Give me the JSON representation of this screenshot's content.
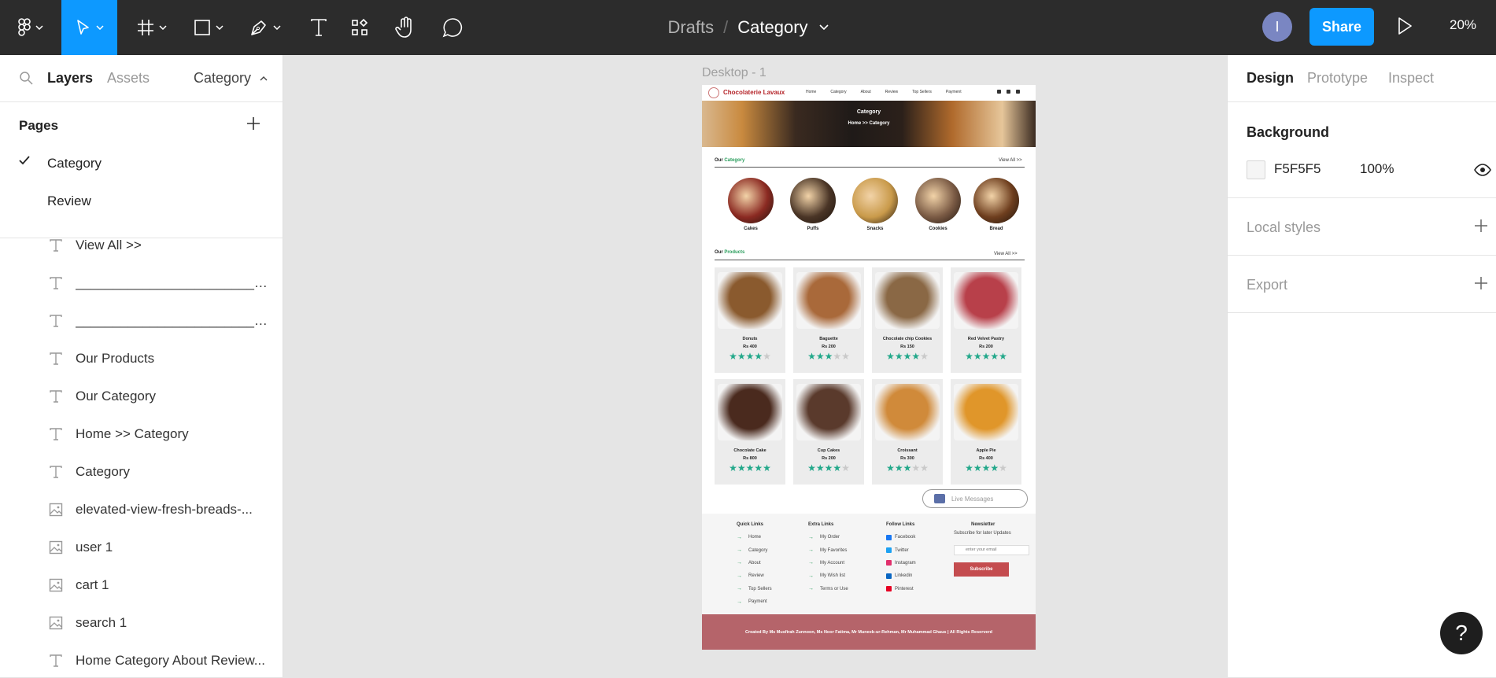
{
  "toolbar": {
    "breadcrumb_parent": "Drafts",
    "breadcrumb_sep": "/",
    "file_name": "Category",
    "avatar_initial": "I",
    "share_label": "Share",
    "zoom": "20%"
  },
  "left_panel": {
    "tabs": [
      "Layers",
      "Assets"
    ],
    "page_selector": "Category",
    "pages_heading": "Pages",
    "pages": [
      {
        "label": "Category",
        "selected": true
      },
      {
        "label": "Review",
        "selected": false
      }
    ],
    "layers": [
      {
        "type": "text",
        "label": "View All >>"
      },
      {
        "type": "text",
        "label": "____________________________________________..."
      },
      {
        "type": "text",
        "label": "____________________________________________..."
      },
      {
        "type": "text",
        "label": "Our Products"
      },
      {
        "type": "text",
        "label": "Our Category"
      },
      {
        "type": "text",
        "label": "Home >> Category"
      },
      {
        "type": "text",
        "label": "Category"
      },
      {
        "type": "image",
        "label": "elevated-view-fresh-breads-..."
      },
      {
        "type": "image",
        "label": "user 1"
      },
      {
        "type": "image",
        "label": "cart 1"
      },
      {
        "type": "image",
        "label": "search 1"
      },
      {
        "type": "text",
        "label": "Home Category About Review..."
      }
    ]
  },
  "right_panel": {
    "tabs": [
      "Design",
      "Prototype",
      "Inspect"
    ],
    "background_heading": "Background",
    "background_hex": "F5F5F5",
    "background_opacity": "100%",
    "local_styles": "Local styles",
    "export": "Export"
  },
  "canvas": {
    "frame_label": "Desktop - 1",
    "frame_bg": "#F5F5F5"
  },
  "site": {
    "brand": "Chocolaterie Lavaux",
    "nav": [
      "Home",
      "Category",
      "About",
      "Review",
      "Top Sellers",
      "Payment"
    ],
    "hero_title": "Category",
    "hero_crumb": "Home >> Category",
    "cat_title_a": "Our",
    "cat_title_b": "Category",
    "cat_viewall": "View All >>",
    "categories": [
      {
        "name": "Cakes",
        "color": "#8b2a22"
      },
      {
        "name": "Puffs",
        "color": "#4a3526"
      },
      {
        "name": "Snacks",
        "color": "#c99a4a"
      },
      {
        "name": "Cookies",
        "color": "#7a5a44"
      },
      {
        "name": "Bread",
        "color": "#6e3e1e"
      }
    ],
    "prod_title_a": "Our",
    "prod_title_b": "Products",
    "prod_viewall": "View All >>",
    "products": [
      {
        "name": "Donuts",
        "price": "Rs 400",
        "rating": 4,
        "color": "#8a5a2e"
      },
      {
        "name": "Baguette",
        "price": "Rs 200",
        "rating": 3,
        "color": "#a9693a"
      },
      {
        "name": "Chocolate chip Cookies",
        "price": "Rs 150",
        "rating": 4,
        "color": "#8a6845"
      },
      {
        "name": "Red Velvet Pastry",
        "price": "Rs 200",
        "rating": 5,
        "color": "#b8404a"
      },
      {
        "name": "Chocolate Cake",
        "price": "Rs 800",
        "rating": 5,
        "color": "#4a2a1e"
      },
      {
        "name": "Cup Cakes",
        "price": "Rs 200",
        "rating": 4,
        "color": "#5a3a2c"
      },
      {
        "name": "Croissant",
        "price": "Rs 300",
        "rating": 3,
        "color": "#d08a3a"
      },
      {
        "name": "Apple Pie",
        "price": "Rs 400",
        "rating": 4,
        "color": "#e0962a"
      }
    ],
    "live_messages": "Live Messages",
    "footer": {
      "quick_links_title": "Quick Links",
      "quick_links": [
        "Home",
        "Category",
        "About",
        "Review",
        "Top Sellers",
        "Payment"
      ],
      "extra_links_title": "Extra Links",
      "extra_links": [
        "My Order",
        "My Favorites",
        "My Account",
        "My Wish list",
        "Terms or Use"
      ],
      "follow_links_title": "Follow Links",
      "follow_links": [
        {
          "name": "Facebook",
          "color": "#1877f2"
        },
        {
          "name": "Twitter",
          "color": "#1da1f2"
        },
        {
          "name": "Instagram",
          "color": "#e1306c"
        },
        {
          "name": "Linkedin",
          "color": "#0a66c2"
        },
        {
          "name": "Pinterest",
          "color": "#e60023"
        }
      ],
      "newsletter_title": "Newsletter",
      "newsletter_sub": "Subscribe for later Updates",
      "newsletter_placeholder": "enter your email",
      "subscribe_label": "Subscribe",
      "copyright": "Created By Ms Musfirah Zunnoon, Ms Noor Fatima, Mr Muneeb-ur-Rehman, Mr Muhammad Ghaus | All Rights Reserverd"
    }
  }
}
